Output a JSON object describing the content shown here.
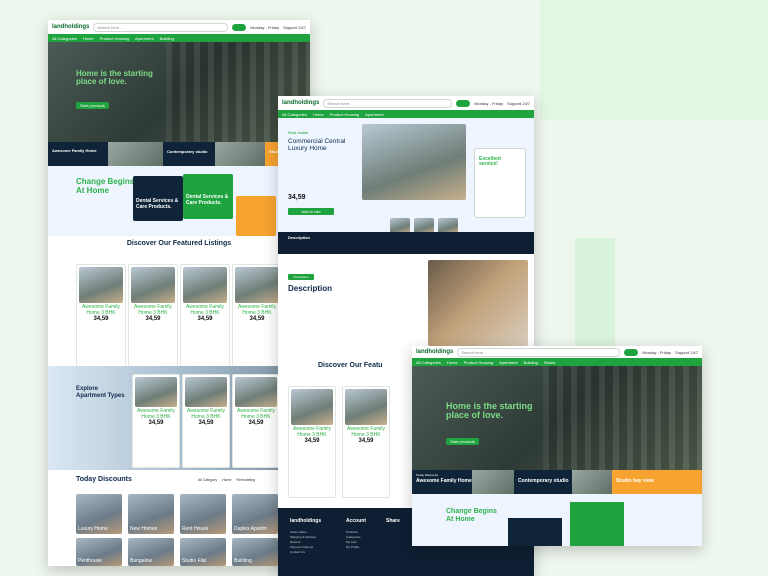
{
  "brand": {
    "logo": "landholdings",
    "accent": "#1fa33e",
    "dark": "#0f2438",
    "orange": "#f7a330"
  },
  "header": {
    "search_placeholder": "Search here...",
    "hours": "Monday - Friday",
    "support": "Support 24/7",
    "cart": "Cart"
  },
  "nav": {
    "categories": "All Categories",
    "items": [
      "Home",
      "Product Housing",
      "Apartment",
      "Building",
      "Stores"
    ]
  },
  "hero": {
    "title_line1": "Home is the starting",
    "title_line2": "place of love.",
    "button": "Start products"
  },
  "promo": {
    "today_discounts": "Today Discounts",
    "card1": "Awesome Family Home",
    "card1_btn": "Buy in Discount",
    "card2": "Contemporary studio",
    "card3": "Studio bay view"
  },
  "change": {
    "title_line1": "Change Begins",
    "title_line2": "At Home",
    "card_dark": "Dental Services & Care Products.",
    "card_green": "Dental Services & Care Products."
  },
  "listings": {
    "title": "Discover Our Featured Listings",
    "name": "Awesome Family Home 3 BHK",
    "price": "34,59",
    "add_label": "Add to cart"
  },
  "apartment": {
    "label": "Today Discounts",
    "title_line1": "Explore",
    "title_line2": "Apartment Types"
  },
  "today_discounts_section": {
    "title": "Today Discounts",
    "filters": [
      "All Category",
      "Home",
      "Remodeling",
      "Apartment"
    ],
    "tiles": [
      "Luxury Home",
      "New Homes",
      "Rent House",
      "Duplex Apartm",
      "Penthouse",
      "Bungalow",
      "Studio Flat",
      "Building"
    ]
  },
  "footer": {
    "brand": "landholdings",
    "account": {
      "title": "Account",
      "items": [
        "Products",
        "Categories",
        "My Cart",
        "My Profile"
      ]
    },
    "share": {
      "title": "Share"
    },
    "links": [
      "Order status",
      "Shipping & Delivery",
      "Returns",
      "Payment Options",
      "Contact Us"
    ]
  },
  "product_detail": {
    "category": "Real estate",
    "title": "Commercial Central Luxury Home",
    "price": "34,59",
    "add": "Add to cart",
    "excellent": "Excellent service!",
    "description": "Description"
  },
  "description_section": {
    "badge": "Description",
    "title": "Description"
  },
  "discover_partial": {
    "title": "Discover Our Featu"
  }
}
